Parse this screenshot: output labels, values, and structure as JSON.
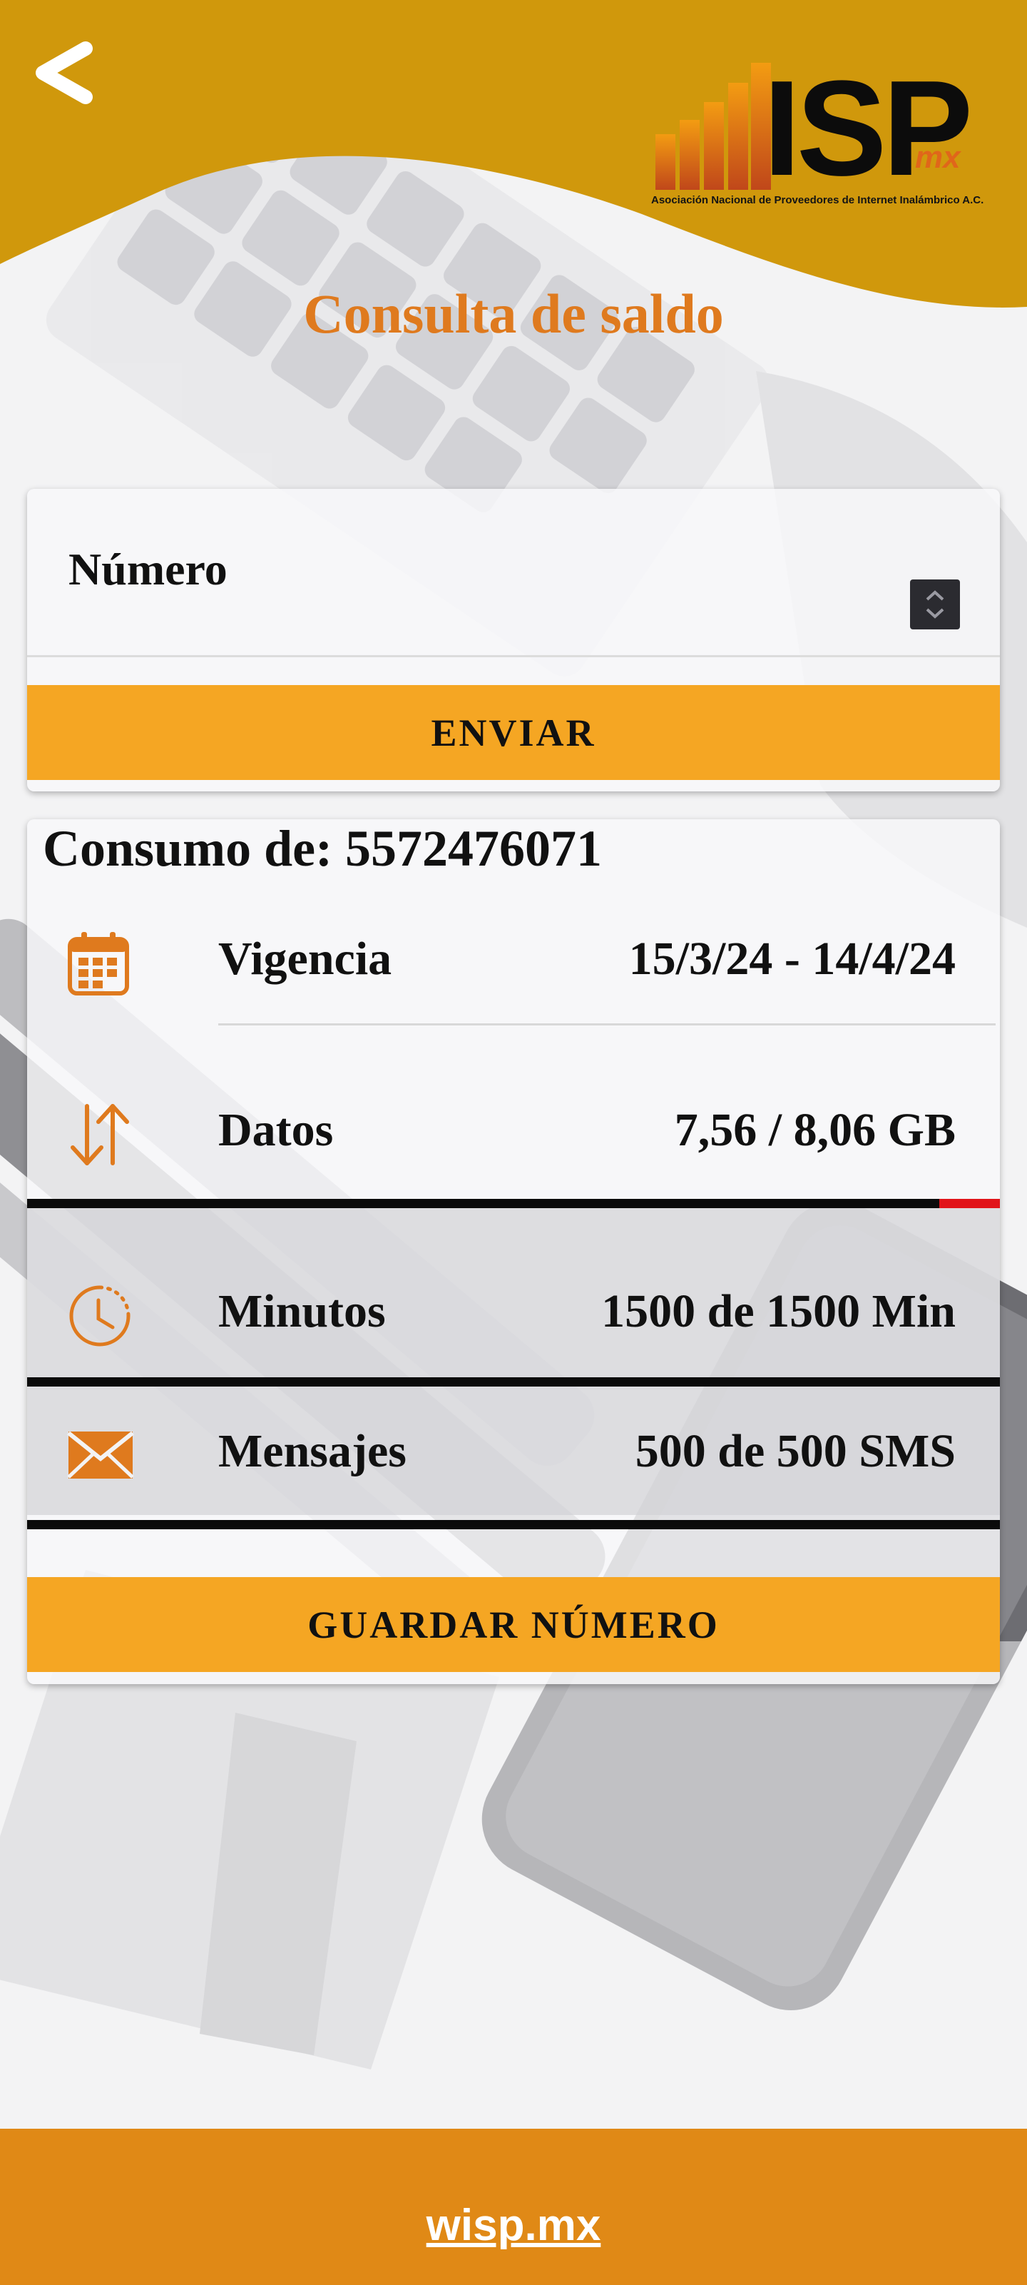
{
  "header": {
    "back_icon": "chevron-left-icon",
    "logo": {
      "brand": "ISP",
      "suffix": "mx",
      "tagline": "Asociación Nacional de Proveedores de Internet Inalámbrico A.C."
    }
  },
  "page": {
    "title": "Consulta de saldo"
  },
  "form": {
    "number_label": "Número",
    "spinner_icon": "spinner-arrows-icon",
    "send_label": "ENVIAR"
  },
  "usage": {
    "title": "Consumo de: 5572476071",
    "rows": [
      {
        "icon": "calendar-icon",
        "label": "Vigencia",
        "value": "15/3/24 - 14/4/24"
      },
      {
        "icon": "up-down-arrows-icon",
        "label": "Datos",
        "value": "7,56 / 8,06 GB",
        "used_fraction": 0.938
      },
      {
        "icon": "clock-icon",
        "label": "Minutos",
        "value": "1500 de 1500 Min",
        "used_fraction": 1.0
      },
      {
        "icon": "envelope-icon",
        "label": "Mensajes",
        "value": "500 de 500 SMS",
        "used_fraction": 1.0
      }
    ],
    "save_label": "GUARDAR NÚMERO"
  },
  "footer": {
    "link": "wisp.mx"
  },
  "colors": {
    "header_gold": "#d0980c",
    "title_orange": "#df7a1e",
    "button_orange": "#f5a623",
    "footer_orange": "#e08916",
    "icon_orange": "#df7a1e",
    "bar_remaining": "#e1141a",
    "bar_used": "#0b0b0b"
  }
}
